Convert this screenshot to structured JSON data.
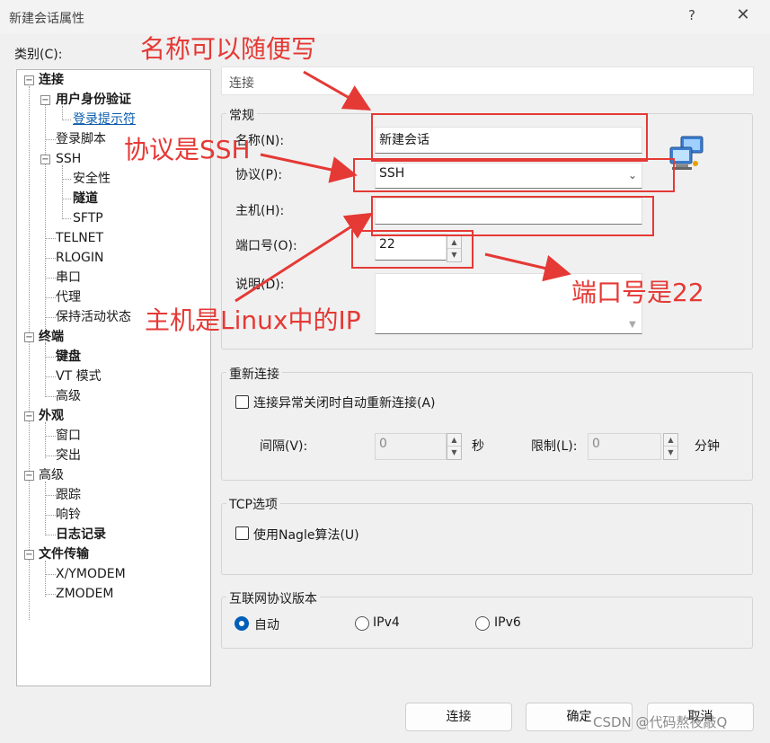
{
  "window": {
    "title": "新建会话属性",
    "help": "?",
    "close": "✕"
  },
  "category_label": "类别(C):",
  "tree": [
    {
      "label": "连接",
      "bold": true
    },
    {
      "label": "用户身份验证",
      "bold": true
    },
    {
      "label": "登录提示符",
      "link": true
    },
    {
      "label": "登录脚本"
    },
    {
      "label": "SSH"
    },
    {
      "label": "安全性"
    },
    {
      "label": "隧道",
      "bold": true
    },
    {
      "label": "SFTP"
    },
    {
      "label": "TELNET"
    },
    {
      "label": "RLOGIN"
    },
    {
      "label": "串口"
    },
    {
      "label": "代理"
    },
    {
      "label": "保持活动状态"
    },
    {
      "label": "终端",
      "bold": true
    },
    {
      "label": "键盘",
      "bold": true
    },
    {
      "label": "VT 模式"
    },
    {
      "label": "高级"
    },
    {
      "label": "外观",
      "bold": true
    },
    {
      "label": "窗口"
    },
    {
      "label": "突出"
    },
    {
      "label": "高级"
    },
    {
      "label": "跟踪"
    },
    {
      "label": "响铃"
    },
    {
      "label": "日志记录",
      "bold": true
    },
    {
      "label": "文件传输",
      "bold": true
    },
    {
      "label": "X/YMODEM"
    },
    {
      "label": "ZMODEM"
    }
  ],
  "header": "连接",
  "general": {
    "title": "常规",
    "name_label": "名称(N):",
    "name_value": "新建会话",
    "protocol_label": "协议(P):",
    "protocol_value": "SSH",
    "host_label": "主机(H):",
    "host_value": "",
    "port_label": "端口号(O):",
    "port_value": "22",
    "desc_label": "说明(D):",
    "desc_value": ""
  },
  "reconnect": {
    "title": "重新连接",
    "checkbox_label": "连接异常关闭时自动重新连接(A)",
    "interval_label": "间隔(V):",
    "interval_value": "0",
    "interval_unit": "秒",
    "limit_label": "限制(L):",
    "limit_value": "0",
    "limit_unit": "分钟"
  },
  "tcp": {
    "title": "TCP选项",
    "nagle_label": "使用Nagle算法(U)"
  },
  "ipver": {
    "title": "互联网协议版本",
    "auto": "自动",
    "ipv4": "IPv4",
    "ipv6": "IPv6",
    "selected": "自动"
  },
  "buttons": {
    "connect": "连接",
    "ok": "确定",
    "cancel": "取消"
  },
  "annotations": {
    "name": "名称可以随便写",
    "protocol": "协议是SSH",
    "host": "主机是Linux中的IP",
    "port": "端口号是22"
  },
  "watermark": "CSDN @代码熬夜敲Q",
  "colors": {
    "annotation": "#e53935",
    "link": "#0b5cad",
    "radio_selected": "#005fb8"
  }
}
